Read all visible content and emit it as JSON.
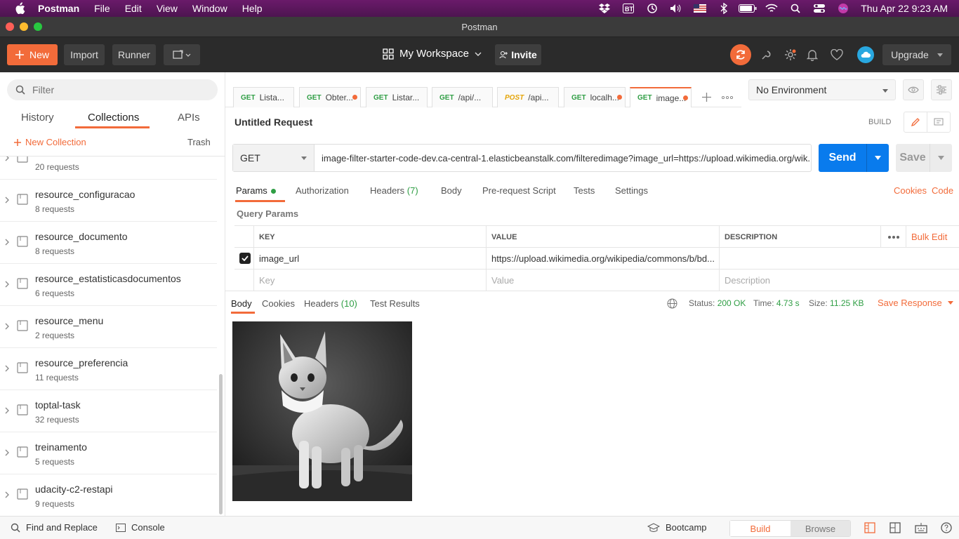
{
  "macbar": {
    "app_name": "Postman",
    "menus": [
      "File",
      "Edit",
      "View",
      "Window",
      "Help"
    ],
    "clock": "Thu Apr 22  9:23 AM"
  },
  "window": {
    "title": "Postman"
  },
  "toolbar": {
    "new_label": "New",
    "import_label": "Import",
    "runner_label": "Runner",
    "workspace_label": "My Workspace",
    "invite_label": "Invite",
    "upgrade_label": "Upgrade"
  },
  "sidebar": {
    "filter_placeholder": "Filter",
    "tabs": [
      "History",
      "Collections",
      "APIs"
    ],
    "active_tab": "Collections",
    "new_collection_label": "New Collection",
    "trash_label": "Trash",
    "collections": [
      {
        "name": "",
        "count": "20 requests"
      },
      {
        "name": "resource_configuracao",
        "count": "8 requests"
      },
      {
        "name": "resource_documento",
        "count": "8 requests"
      },
      {
        "name": "resource_estatisticasdocumentos",
        "count": "6 requests"
      },
      {
        "name": "resource_menu",
        "count": "2 requests"
      },
      {
        "name": "resource_preferencia",
        "count": "11 requests"
      },
      {
        "name": "toptal-task",
        "count": "32 requests"
      },
      {
        "name": "treinamento",
        "count": "5 requests"
      },
      {
        "name": "udacity-c2-restapi",
        "count": "9 requests"
      }
    ]
  },
  "request_tabs": [
    {
      "method": "GET",
      "name": "Lista..."
    },
    {
      "method": "GET",
      "name": "Obter...",
      "dot": true
    },
    {
      "method": "GET",
      "name": "Listar..."
    },
    {
      "method": "GET",
      "name": "/api/..."
    },
    {
      "method": "POST",
      "name": "/api..."
    },
    {
      "method": "GET",
      "name": "localh...",
      "dot": true
    },
    {
      "method": "GET",
      "name": "image...",
      "dot": true,
      "active": true
    }
  ],
  "environment": {
    "selected": "No Environment"
  },
  "request": {
    "title": "Untitled Request",
    "mode_label": "BUILD",
    "method": "GET",
    "url": "image-filter-starter-code-dev.ca-central-1.elasticbeanstalk.com/filteredimage?image_url=https://upload.wikimedia.org/wik...",
    "send_label": "Send",
    "save_label": "Save",
    "subtabs": {
      "params": "Params",
      "authorization": "Authorization",
      "headers": "Headers",
      "headers_count": "(7)",
      "body": "Body",
      "prerequest": "Pre-request Script",
      "tests": "Tests",
      "settings": "Settings"
    },
    "cookies_label": "Cookies",
    "code_label": "Code",
    "query_params_label": "Query Params",
    "table": {
      "headers": [
        "KEY",
        "VALUE",
        "DESCRIPTION"
      ],
      "bulk_edit": "Bulk Edit",
      "rows": [
        {
          "key": "image_url",
          "value": "https://upload.wikimedia.org/wikipedia/commons/b/bd...",
          "description": "",
          "checked": true
        }
      ],
      "placeholders": {
        "key": "Key",
        "value": "Value",
        "description": "Description"
      }
    }
  },
  "response": {
    "tabs": {
      "body": "Body",
      "cookies": "Cookies",
      "headers": "Headers",
      "headers_count": "(10)",
      "tests": "Test Results"
    },
    "status_label": "Status:",
    "status": "200 OK",
    "time_label": "Time:",
    "time": "4.73 s",
    "size_label": "Size:",
    "size": "11.25 KB",
    "save_response_label": "Save Response"
  },
  "bottombar": {
    "find_replace": "Find and Replace",
    "console": "Console",
    "bootcamp": "Bootcamp",
    "build": "Build",
    "browse": "Browse"
  },
  "colors": {
    "accent": "#f26b3a",
    "send_blue": "#097bed",
    "success_green": "#2f9e44"
  }
}
